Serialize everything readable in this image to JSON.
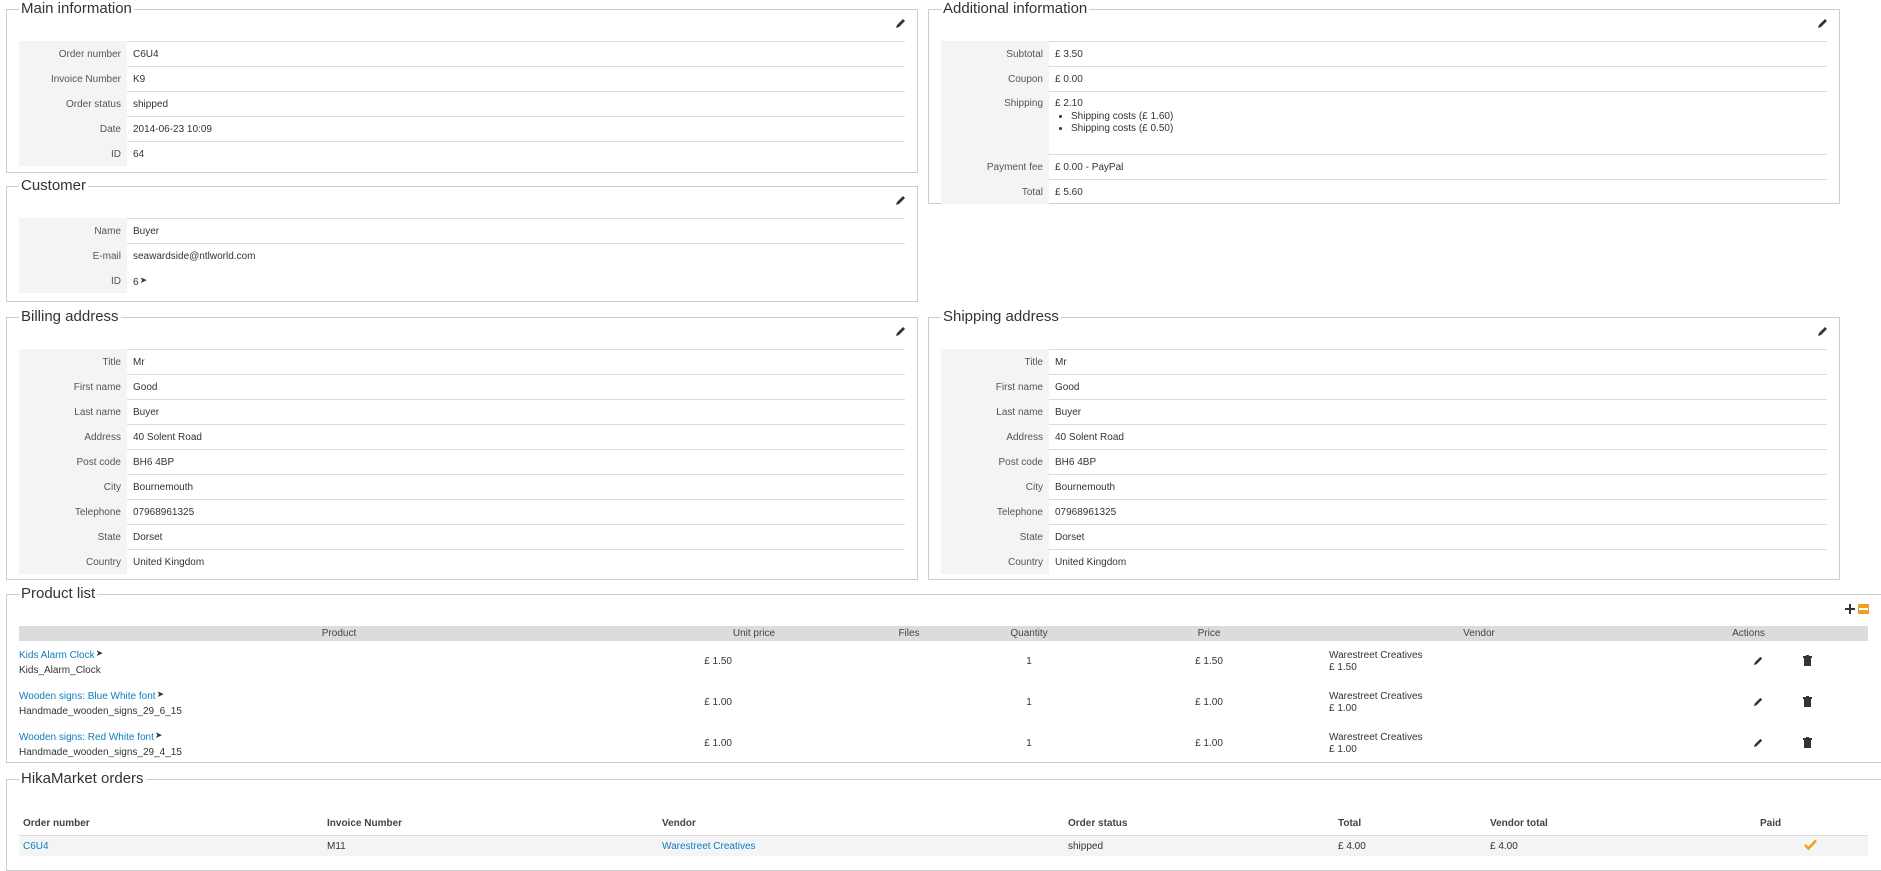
{
  "main_info": {
    "legend": "Main information",
    "rows": [
      {
        "label": "Order number",
        "value": "C6U4"
      },
      {
        "label": "Invoice Number",
        "value": "K9"
      },
      {
        "label": "Order status",
        "value": "shipped"
      },
      {
        "label": "Date",
        "value": "2014-06-23 10:09"
      },
      {
        "label": "ID",
        "value": "64"
      }
    ]
  },
  "additional_info": {
    "legend": "Additional information",
    "subtotal_label": "Subtotal",
    "subtotal": "£ 3.50",
    "coupon_label": "Coupon",
    "coupon": "£ 0.00",
    "shipping_label": "Shipping",
    "shipping": "£ 2.10",
    "shipping_items": [
      "Shipping costs (£ 1.60)",
      "Shipping costs (£ 0.50)"
    ],
    "payment_label": "Payment fee",
    "payment": "£ 0.00 - PayPal",
    "total_label": "Total",
    "total": "£ 5.60"
  },
  "customer": {
    "legend": "Customer",
    "rows": [
      {
        "label": "Name",
        "value": "Buyer"
      },
      {
        "label": "E-mail",
        "value": "seawardside@ntlworld.com"
      },
      {
        "label": "ID",
        "value": "6"
      }
    ]
  },
  "billing": {
    "legend": "Billing address",
    "rows": [
      {
        "label": "Title",
        "value": "Mr"
      },
      {
        "label": "First name",
        "value": "Good"
      },
      {
        "label": "Last name",
        "value": "Buyer"
      },
      {
        "label": "Address",
        "value": "40 Solent Road"
      },
      {
        "label": "Post code",
        "value": "BH6 4BP"
      },
      {
        "label": "City",
        "value": "Bournemouth"
      },
      {
        "label": "Telephone",
        "value": "07968961325"
      },
      {
        "label": "State",
        "value": "Dorset"
      },
      {
        "label": "Country",
        "value": "United Kingdom"
      }
    ]
  },
  "shipping": {
    "legend": "Shipping address",
    "rows": [
      {
        "label": "Title",
        "value": "Mr"
      },
      {
        "label": "First name",
        "value": "Good"
      },
      {
        "label": "Last name",
        "value": "Buyer"
      },
      {
        "label": "Address",
        "value": "40 Solent Road"
      },
      {
        "label": "Post code",
        "value": "BH6 4BP"
      },
      {
        "label": "City",
        "value": "Bournemouth"
      },
      {
        "label": "Telephone",
        "value": "07968961325"
      },
      {
        "label": "State",
        "value": "Dorset"
      },
      {
        "label": "Country",
        "value": "United Kingdom"
      }
    ]
  },
  "products": {
    "legend": "Product list",
    "headers": {
      "product": "Product",
      "unit_price": "Unit price",
      "files": "Files",
      "quantity": "Quantity",
      "price": "Price",
      "vendor": "Vendor",
      "actions": "Actions"
    },
    "rows": [
      {
        "name": "Kids Alarm Clock",
        "code": "Kids_Alarm_Clock",
        "unit_price": "£ 1.50",
        "quantity": "1",
        "price": "£ 1.50",
        "vendor": "Warestreet Creatives",
        "vendor_price": "£ 1.50"
      },
      {
        "name": "Wooden signs: Blue White font",
        "code": "Handmade_wooden_signs_29_6_15",
        "unit_price": "£ 1.00",
        "quantity": "1",
        "price": "£ 1.00",
        "vendor": "Warestreet Creatives",
        "vendor_price": "£ 1.00"
      },
      {
        "name": "Wooden signs: Red White font",
        "code": "Handmade_wooden_signs_29_4_15",
        "unit_price": "£ 1.00",
        "quantity": "1",
        "price": "£ 1.00",
        "vendor": "Warestreet Creatives",
        "vendor_price": "£ 1.00"
      }
    ]
  },
  "hikamarket": {
    "legend": "HikaMarket orders",
    "headers": {
      "order_number": "Order number",
      "invoice_number": "Invoice Number",
      "vendor": "Vendor",
      "order_status": "Order status",
      "total": "Total",
      "vendor_total": "Vendor total",
      "paid": "Paid"
    },
    "rows": [
      {
        "order_number": "C6U4",
        "invoice_number": "M11",
        "vendor": "Warestreet Creatives",
        "order_status": "shipped",
        "total": "£ 4.00",
        "vendor_total": "£ 4.00"
      }
    ]
  },
  "colors": {
    "link": "#0a7ec2",
    "check": "#f0a020",
    "border": "#cccccc",
    "label_bg": "#f4f4f4"
  },
  "icons": {
    "edit": "pencil-icon",
    "arrow": "arrow-right-icon",
    "add": "plus-icon",
    "minus": "minus-icon",
    "delete": "trash-icon",
    "paid": "checkmark-icon"
  }
}
